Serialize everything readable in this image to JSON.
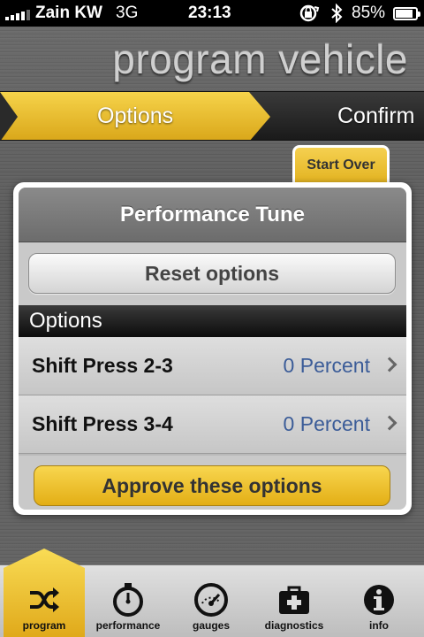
{
  "status_bar": {
    "carrier": "Zain KW",
    "network": "3G",
    "time": "23:13",
    "battery": "85%",
    "battery_level": 0.85
  },
  "app_title": "program vehicle",
  "steps": {
    "active": "Options",
    "next": "Confirm"
  },
  "start_over_label": "Start Over",
  "panel": {
    "title": "Performance Tune",
    "reset_label": "Reset options",
    "section_label": "Options",
    "options": [
      {
        "name": "Shift Press 2-3",
        "value": "0 Percent"
      },
      {
        "name": "Shift Press 3-4",
        "value": "0 Percent"
      }
    ],
    "approve_label": "Approve these options"
  },
  "tabs": [
    {
      "label": "program",
      "icon": "shuffle-icon",
      "active": true
    },
    {
      "label": "performance",
      "icon": "stopwatch-icon",
      "active": false
    },
    {
      "label": "gauges",
      "icon": "gauge-icon",
      "active": false
    },
    {
      "label": "diagnostics",
      "icon": "first-aid-kit-icon",
      "active": false
    },
    {
      "label": "info",
      "icon": "info-icon",
      "active": false
    }
  ],
  "colors": {
    "accent": "#f0c431",
    "value_text": "#3b5c98"
  }
}
